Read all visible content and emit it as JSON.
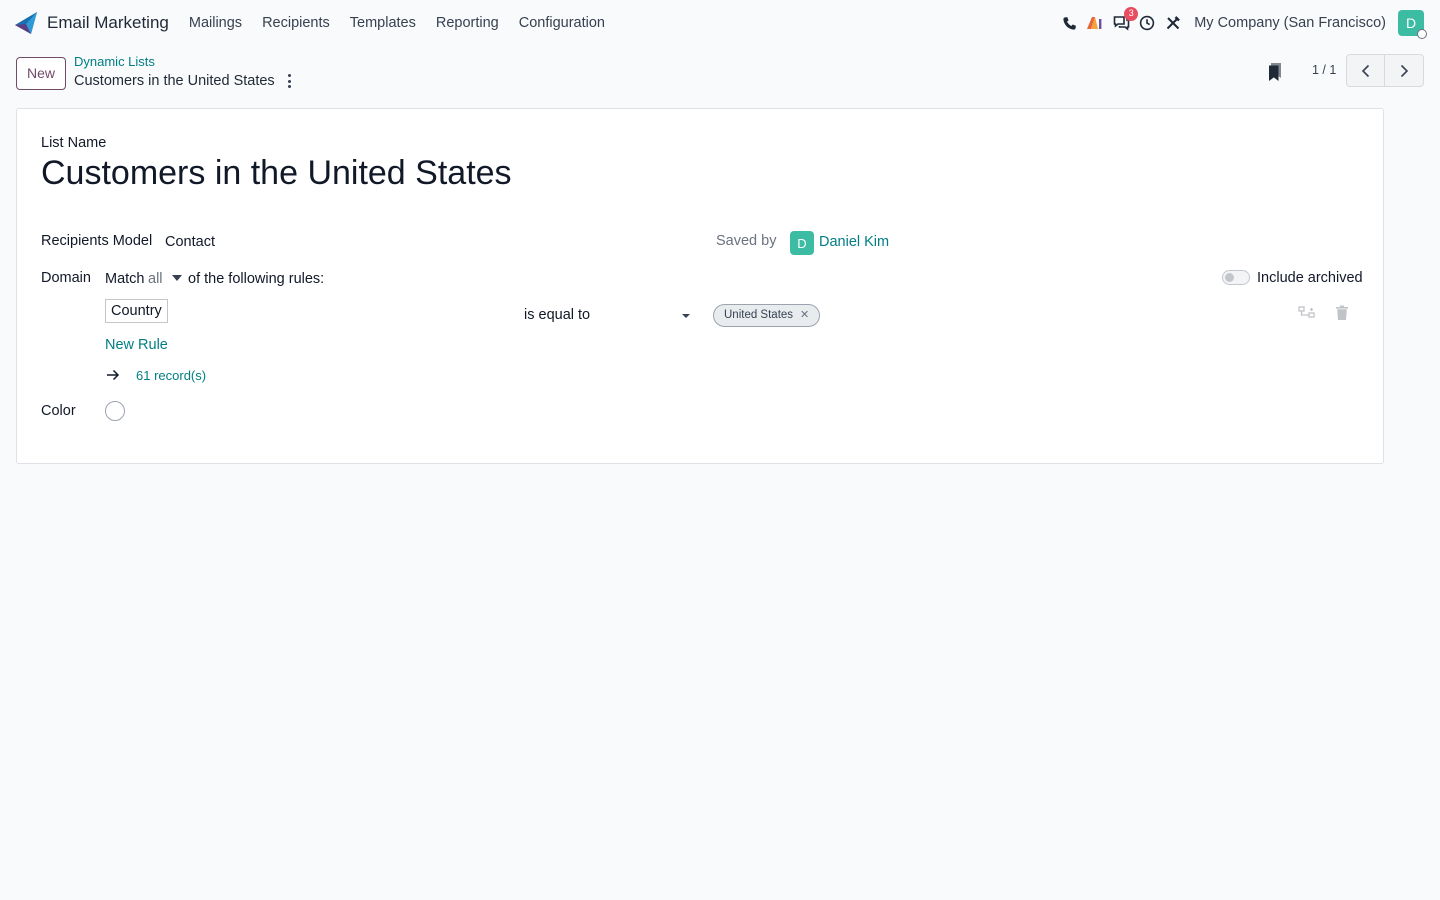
{
  "navbar": {
    "app_name": "Email Marketing",
    "menu": [
      "Mailings",
      "Recipients",
      "Templates",
      "Reporting",
      "Configuration"
    ],
    "messages_badge": "3",
    "company": "My Company (San Francisco)",
    "user_initial": "D"
  },
  "control_panel": {
    "new_label": "New",
    "breadcrumb_parent": "Dynamic Lists",
    "breadcrumb_current": "Customers in the United States",
    "pager_value": "1 / 1"
  },
  "form": {
    "list_name_label": "List Name",
    "list_name": "Customers in the United States",
    "recipients_model_label": "Recipients Model",
    "recipients_model": "Contact",
    "saved_by_label": "Saved by",
    "saved_by_initial": "D",
    "saved_by_name": "Daniel Kim",
    "domain_label": "Domain",
    "match_prefix": "Match",
    "match_mode": "all",
    "match_suffix": "of the following rules:",
    "include_archived_label": "Include archived",
    "rule": {
      "field": "Country",
      "operator": "is equal to",
      "value_tag": "United States"
    },
    "new_rule_label": "New Rule",
    "records_count": "61 record(s)",
    "color_label": "Color"
  },
  "colors": {
    "brand": "#714b67",
    "link": "#017e84",
    "avatar": "#3cbca2",
    "badge": "#e74c5f"
  }
}
